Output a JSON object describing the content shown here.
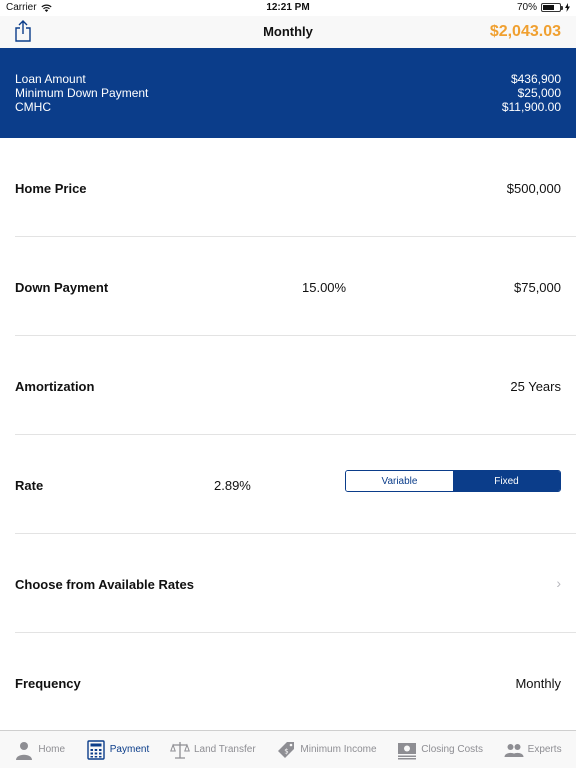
{
  "status": {
    "carrier": "Carrier",
    "time": "12:21 PM",
    "battery": "70%"
  },
  "nav": {
    "title": "Monthly",
    "total": "$2,043.03"
  },
  "summary": {
    "rows": [
      {
        "label": "Loan Amount",
        "value": "$436,900"
      },
      {
        "label": "Minimum Down Payment",
        "value": "$25,000"
      },
      {
        "label": "CMHC",
        "value": "$11,900.00"
      }
    ]
  },
  "form": {
    "home_price": {
      "label": "Home Price",
      "value": "$500,000"
    },
    "down_payment": {
      "label": "Down Payment",
      "percent": "15.00%",
      "value": "$75,000"
    },
    "amortization": {
      "label": "Amortization",
      "value": "25 Years"
    },
    "rate": {
      "label": "Rate",
      "value": "2.89%",
      "options": [
        "Variable",
        "Fixed"
      ],
      "selected": "Fixed"
    },
    "choose_rates": {
      "label": "Choose from Available Rates"
    },
    "frequency": {
      "label": "Frequency",
      "value": "Monthly"
    }
  },
  "tabs": [
    {
      "label": "Home",
      "icon": "person-icon"
    },
    {
      "label": "Payment",
      "icon": "calculator-icon"
    },
    {
      "label": "Land Transfer",
      "icon": "scales-icon"
    },
    {
      "label": "Minimum Income",
      "icon": "tag-icon"
    },
    {
      "label": "Closing Costs",
      "icon": "money-icon"
    },
    {
      "label": "Experts",
      "icon": "people-icon"
    }
  ],
  "active_tab": "Payment",
  "colors": {
    "brand": "#0b3d8a",
    "total": "#f0a030",
    "tab_inactive": "#8e8e93"
  }
}
